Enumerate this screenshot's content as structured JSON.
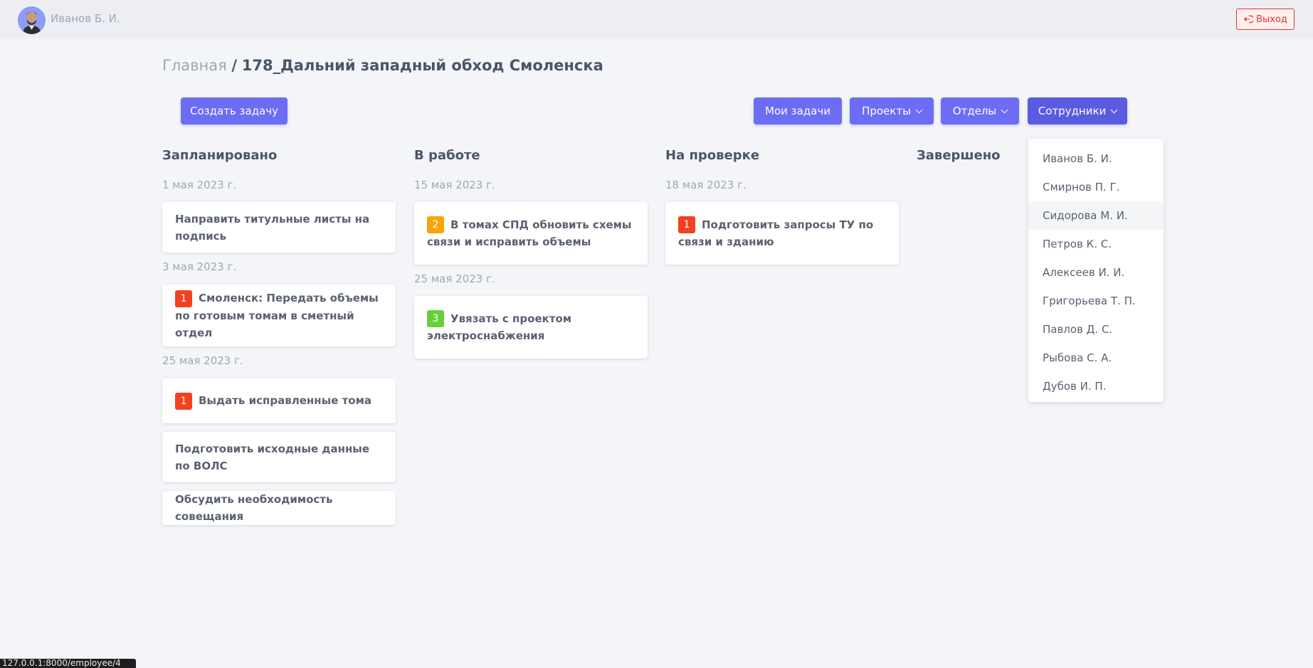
{
  "header": {
    "user_name": "Иванов Б. И.",
    "logout_label": "Выход"
  },
  "breadcrumb": {
    "home": "Главная",
    "separator": "/",
    "project": "178_Дальний западный обход Смоленска"
  },
  "toolbar": {
    "create_task": "Создать задачу",
    "my_tasks": "Мои задачи",
    "projects": "Проекты",
    "departments": "Отделы",
    "employees": "Сотрудники"
  },
  "columns": [
    {
      "title": "Запланировано",
      "groups": [
        {
          "date": "1 мая 2023 г.",
          "cards": [
            {
              "badge": "",
              "text": "Направить титульные листы на подпись"
            }
          ]
        },
        {
          "date": "3 мая 2023 г.",
          "cards": [
            {
              "badge": "1",
              "text": "Смоленск: Передать объемы по готовым томам в сметный отдел"
            }
          ]
        },
        {
          "date": "25 мая 2023 г.",
          "cards": [
            {
              "badge": "1",
              "text": "Выдать исправленные тома"
            },
            {
              "badge": "",
              "text": "Подготовить исходные данные по ВОЛС"
            },
            {
              "badge": "",
              "text": "Обсудить необходимость совещания"
            }
          ]
        }
      ]
    },
    {
      "title": "В работе",
      "groups": [
        {
          "date": "15 мая 2023 г.",
          "cards": [
            {
              "badge": "2",
              "text": "В томах СПД обновить схемы связи и исправить объемы"
            }
          ]
        },
        {
          "date": "25 мая 2023 г.",
          "cards": [
            {
              "badge": "3",
              "text": "Увязать с проектом электроснабжения"
            }
          ]
        }
      ]
    },
    {
      "title": "На проверке",
      "groups": [
        {
          "date": "18 мая 2023 г.",
          "cards": [
            {
              "badge": "1",
              "text": "Подготовить запросы ТУ по связи и зданию"
            }
          ]
        }
      ]
    },
    {
      "title": "Завершено",
      "groups": []
    }
  ],
  "employees_dropdown": [
    "Иванов Б. И.",
    "Смирнов П. Г.",
    "Сидорова М. И.",
    "Петров К. С.",
    "Алексеев И. И.",
    "Григорьева Т. П.",
    "Павлов Д. С.",
    "Рыбова С. А.",
    "Дубов И. П."
  ],
  "status_bar_url": "127.0.0.1:8000/employee/4",
  "colors": {
    "accent": "#6c6cf5",
    "badge_priority_1": "#f2411f",
    "badge_priority_2": "#f9a40a",
    "badge_priority_3": "#67cf3b",
    "logout": "#e3342f"
  }
}
